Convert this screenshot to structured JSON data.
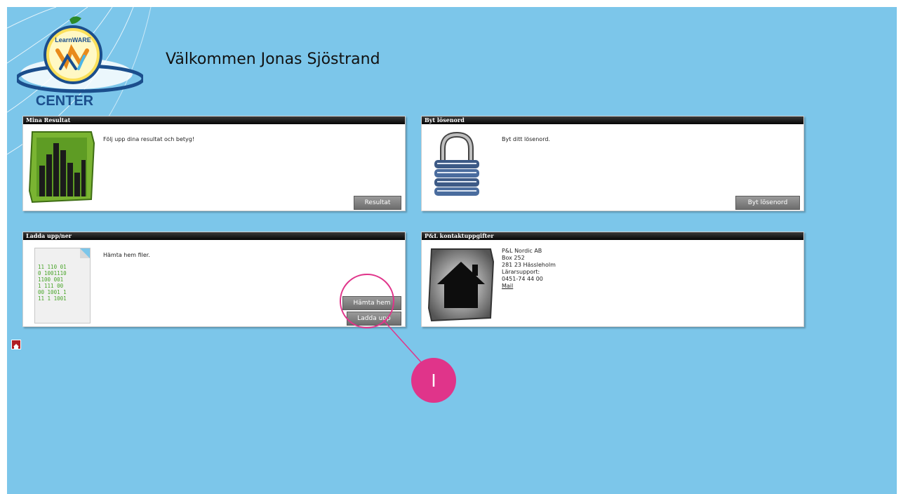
{
  "header": {
    "logo_top": "LearnWARE",
    "logo_bottom": "CENTER",
    "welcome": "Välkommen Jonas Sjöstrand"
  },
  "panels": {
    "results": {
      "title": "Mina Resultat",
      "text": "Följ upp dina resultat och betyg!",
      "button": "Resultat",
      "icon": "bar-chart-icon"
    },
    "password": {
      "title": "Byt lösenord",
      "text": "Byt ditt lösenord.",
      "button": "Byt lösenord",
      "icon": "padlock-icon"
    },
    "files": {
      "title": "Ladda upp/ner",
      "text": "Hämta hem filer.",
      "download_button": "Hämta hem",
      "upload_button": "Ladda upp",
      "icon": "binary-file-icon",
      "binary_lines": [
        "11 110 01",
        "0 1001110",
        "1100 001",
        "1 111 00",
        "00 1001 1",
        "11 1 1001"
      ]
    },
    "contact": {
      "title": "P&L kontaktuppgifter",
      "company": "P&L Nordic AB",
      "address1": "Box 252",
      "address2": "281 23 Hässleholm",
      "support_label": "Lärarsupport:",
      "phone": "0451-74 44 00",
      "mail_link": "Mail",
      "icon": "home-icon"
    }
  },
  "callout": {
    "label": "I",
    "color": "#e0348a"
  },
  "colors": {
    "background": "#7cc6ea",
    "header_bar": "#000000",
    "button": "#7d7d7d"
  }
}
